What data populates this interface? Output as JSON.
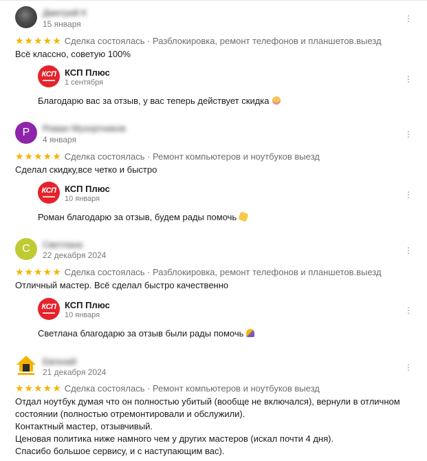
{
  "colors": {
    "star": "#f4b400",
    "brand_red": "#e4232b",
    "avatar_purple": "#8e24aa",
    "avatar_lime": "#c0ca33"
  },
  "reviews": [
    {
      "avatar_type": "photo",
      "author": "Дмитрий К",
      "date": "15 января",
      "rating": 5,
      "stars": "★★★★★",
      "meta": "Сделка состоялась · Разблокировка, ремонт телефонов и планшетов.выезд",
      "text": "Всё классно, советую 100%",
      "reply": {
        "logo": "КСП",
        "name": "КСП Плюс",
        "date": "1 сентября",
        "text": "Благодарю вас за отзыв, у вас теперь действует скидка",
        "emoji_icon": "smiling-face-icon"
      }
    },
    {
      "avatar_type": "letter",
      "avatar_letter": "Р",
      "author": "Роман Мухортников",
      "date": "4 января",
      "rating": 5,
      "stars": "★★★★★",
      "meta": "Сделка состоялась · Ремонт компьютеров и ноутбуков выезд",
      "text": "Сделал скидку,все четко и быстро",
      "reply": {
        "logo": "КСП",
        "name": "КСП Плюс",
        "date": "10 января",
        "text": "Роман благодарю за отзыв, будем рады помочь",
        "emoji_icon": "handshake-icon"
      }
    },
    {
      "avatar_type": "letter",
      "avatar_letter": "С",
      "author": "Светлана",
      "date": "22 декабря 2024",
      "rating": 5,
      "stars": "★★★★★",
      "meta": "Сделка состоялась · Разблокировка, ремонт телефонов и планшетов.выезд",
      "text": "Отличный мастер. Всё сделал быстро качественно",
      "reply": {
        "logo": "КСП",
        "name": "КСП Плюс",
        "date": "10 января",
        "text": "Светлана благодарю за отзыв были рады помочь",
        "emoji_icon": "folded-hands-icon"
      }
    },
    {
      "avatar_type": "house",
      "author": "Евгений",
      "date": "21 декабря 2024",
      "rating": 5,
      "stars": "★★★★★",
      "meta": "Сделка состоялась · Ремонт компьютеров и ноутбуков выезд",
      "text": "Отдал ноутбук думая что он полностью убитый (вообще не включался), вернули в отличном\nсостоянии (полностью отремонтировали и обслужили).\nКонтактный мастер, отзывчивый.\nЦеновая политика ниже намного чем у других мастеров (искал почти 4 дня).\nСпасибо большое сервису, и с наступающим вас)."
    }
  ]
}
